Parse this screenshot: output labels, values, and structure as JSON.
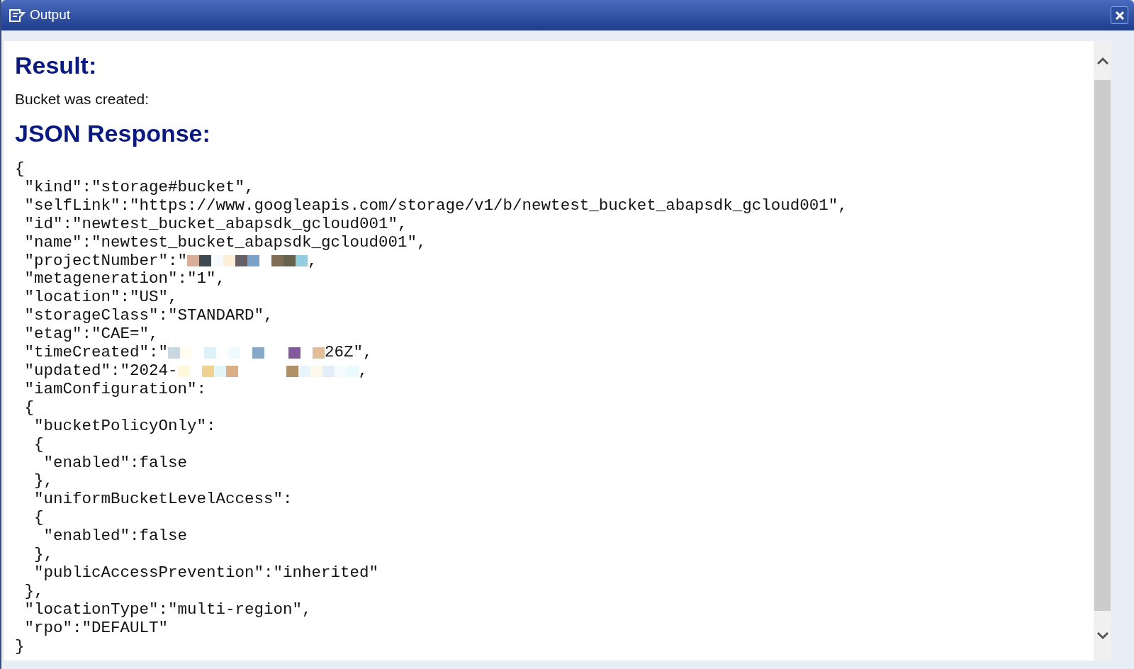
{
  "window": {
    "title": "Output"
  },
  "result": {
    "heading": "Result:",
    "message": "Bucket was created:"
  },
  "response": {
    "heading": "JSON Response:",
    "lines": [
      {
        "kind": "plain",
        "text": "{"
      },
      {
        "kind": "plain",
        "text": " \"kind\":\"storage#bucket\","
      },
      {
        "kind": "plain",
        "text": " \"selfLink\":\"https://www.googleapis.com/storage/v1/b/newtest_bucket_abapsdk_gcloud001\","
      },
      {
        "kind": "plain",
        "text": " \"id\":\"newtest_bucket_abapsdk_gcloud001\","
      },
      {
        "kind": "plain",
        "text": " \"name\":\"newtest_bucket_abapsdk_gcloud001\","
      },
      {
        "kind": "redacted",
        "before": " \"projectNumber\":\"",
        "after": ","
      },
      {
        "kind": "plain",
        "text": " \"metageneration\":\"1\","
      },
      {
        "kind": "plain",
        "text": " \"location\":\"US\","
      },
      {
        "kind": "plain",
        "text": " \"storageClass\":\"STANDARD\","
      },
      {
        "kind": "plain",
        "text": " \"etag\":\"CAE=\","
      },
      {
        "kind": "redacted",
        "before": " \"timeCreated\":\"",
        "after": "26Z\","
      },
      {
        "kind": "redacted",
        "before": " \"updated\":\"2024-",
        "after": ","
      },
      {
        "kind": "plain",
        "text": " \"iamConfiguration\":"
      },
      {
        "kind": "plain",
        "text": " {"
      },
      {
        "kind": "plain",
        "text": "  \"bucketPolicyOnly\":"
      },
      {
        "kind": "plain",
        "text": "  {"
      },
      {
        "kind": "plain",
        "text": "   \"enabled\":false"
      },
      {
        "kind": "plain",
        "text": "  },"
      },
      {
        "kind": "plain",
        "text": "  \"uniformBucketLevelAccess\":"
      },
      {
        "kind": "plain",
        "text": "  {"
      },
      {
        "kind": "plain",
        "text": "   \"enabled\":false"
      },
      {
        "kind": "plain",
        "text": "  },"
      },
      {
        "kind": "plain",
        "text": "  \"publicAccessPrevention\":\"inherited\""
      },
      {
        "kind": "plain",
        "text": " },"
      },
      {
        "kind": "plain",
        "text": " \"locationType\":\"multi-region\","
      },
      {
        "kind": "plain",
        "text": " \"rpo\":\"DEFAULT\""
      },
      {
        "kind": "plain",
        "text": "}"
      }
    ]
  }
}
